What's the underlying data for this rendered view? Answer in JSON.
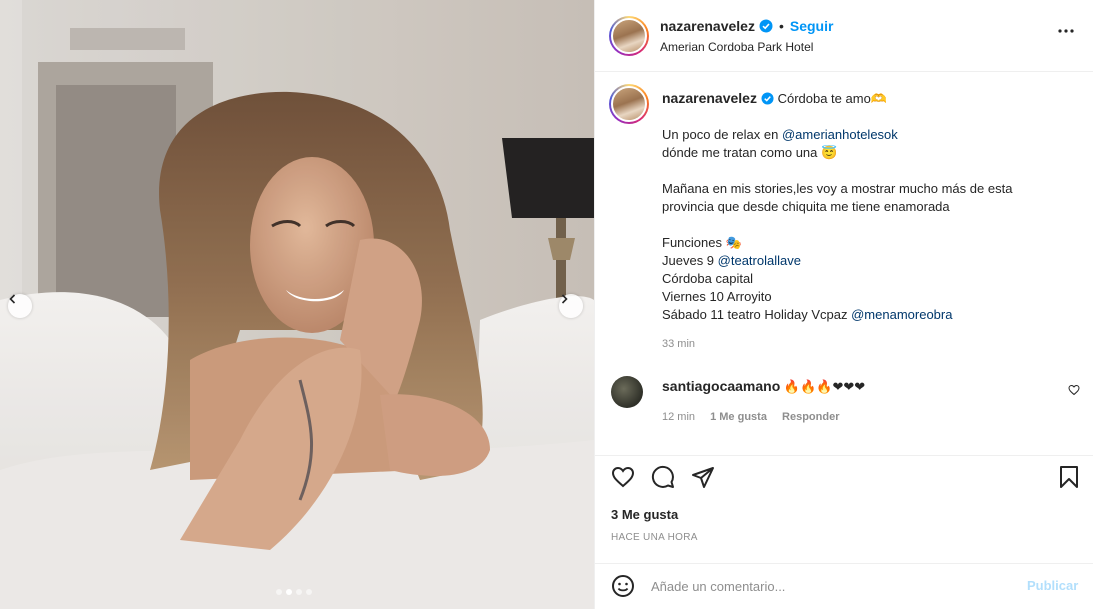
{
  "post": {
    "username": "nazarenavelez",
    "follow_label": "Seguir",
    "bullet": "•",
    "location": "Amerian Cordoba Park Hotel"
  },
  "caption": {
    "username": "nazarenavelez",
    "first_line": "Córdoba te amo🫶",
    "lines": [
      {
        "text": "Un poco de relax en ",
        "mention": "@amerianhotelesok"
      },
      {
        "text": "dónde me tratan como una 😇",
        "mention": ""
      },
      {
        "text": "",
        "mention": ""
      },
      {
        "text": "Mañana en mis stories,les voy a mostrar mucho más de esta",
        "mention": ""
      },
      {
        "text": "provincia que desde chiquita me tiene enamorada",
        "mention": ""
      },
      {
        "text": "",
        "mention": ""
      },
      {
        "text": "Funciones 🎭",
        "mention": ""
      },
      {
        "text": "Jueves 9 ",
        "mention": "@teatrolallave"
      },
      {
        "text": "Córdoba capital",
        "mention": ""
      },
      {
        "text": "Viernes 10 Arroyito",
        "mention": ""
      },
      {
        "text": "Sábado 11 teatro Holiday Vcpaz ",
        "mention": "@menamoreobra"
      }
    ],
    "time_ago": "33 min"
  },
  "comment": {
    "username": "santiagocaamano",
    "text": "🔥🔥🔥❤❤❤",
    "time": "12 min",
    "likes": "1 Me gusta",
    "reply": "Responder"
  },
  "actions": {
    "likes": "3 Me gusta",
    "posted": "HACE UNA HORA"
  },
  "comment_box": {
    "placeholder": "Añade un comentario...",
    "publish": "Publicar"
  },
  "carousel": {
    "total": 4,
    "active_index": 1
  },
  "colors": {
    "link": "#0095f6",
    "mention": "#00376b",
    "muted": "#8e8e8e",
    "publish_disabled": "#b2dffc"
  }
}
